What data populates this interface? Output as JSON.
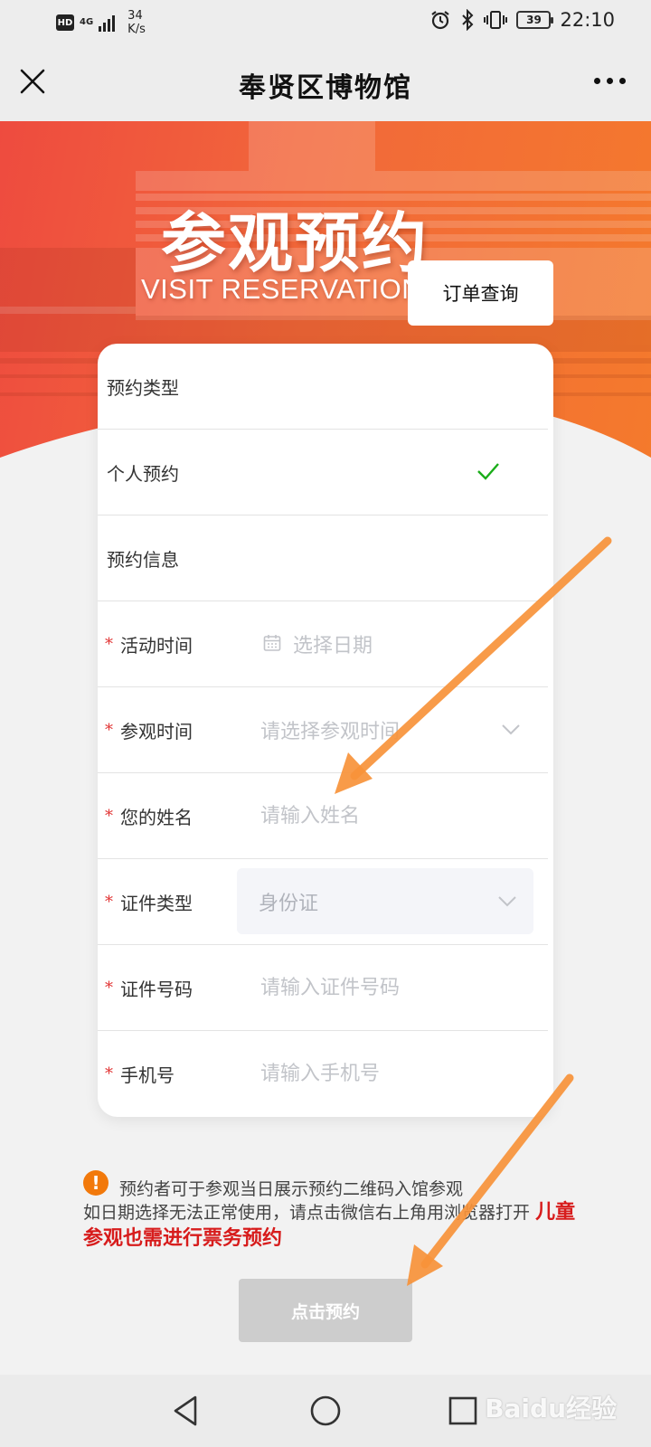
{
  "status_bar": {
    "hd": "HD",
    "network": "4G",
    "speed_value": "34",
    "speed_unit": "K/s",
    "battery": "39",
    "time": "22:10"
  },
  "title_bar": {
    "title": "奉贤区博物馆"
  },
  "hero": {
    "title": "参观预约",
    "subtitle": "VISIT RESERVATION",
    "order_query_label": "订单查询"
  },
  "form": {
    "reservation_type_label": "预约类型",
    "personal_option_label": "个人预约",
    "personal_option_selected": true,
    "info_label": "预约信息",
    "required_mark": "*",
    "fields": {
      "activity_time": {
        "label": "活动时间",
        "placeholder": "选择日期"
      },
      "visit_time": {
        "label": "参观时间",
        "placeholder": "请选择参观时间"
      },
      "name": {
        "label": "您的姓名",
        "placeholder": "请输入姓名"
      },
      "id_type": {
        "label": "证件类型",
        "value": "身份证"
      },
      "id_number": {
        "label": "证件号码",
        "placeholder": "请输入证件号码"
      },
      "phone": {
        "label": "手机号",
        "placeholder": "请输入手机号"
      }
    }
  },
  "notice": {
    "icon": "!",
    "line1": "预约者可于参观当日展示预约二维码入馆参观",
    "line2": "如日期选择无法正常使用，请点击微信右上角用浏览器打开",
    "emphasis": "儿童参观也需进行票务预约"
  },
  "submit": {
    "label": "点击预约"
  },
  "watermark": {
    "text": "Baidu经验"
  },
  "colors": {
    "hero_start": "#ee4b3f",
    "hero_end": "#f47a2c",
    "required": "#e13333",
    "check": "#1aad19",
    "warning": "#f2790b",
    "emphasis": "#d71c1c",
    "annotation_arrow": "#f7923a",
    "submit_disabled": "#cdcdcd"
  },
  "icons": {
    "close": "close-icon",
    "more": "more-dots-icon",
    "check": "check-icon",
    "calendar": "calendar-icon",
    "dropdown": "chevron-down-icon",
    "warning": "warning-icon",
    "nav_back": "back-triangle-icon",
    "nav_home": "home-circle-icon",
    "nav_recent": "recent-square-icon"
  }
}
